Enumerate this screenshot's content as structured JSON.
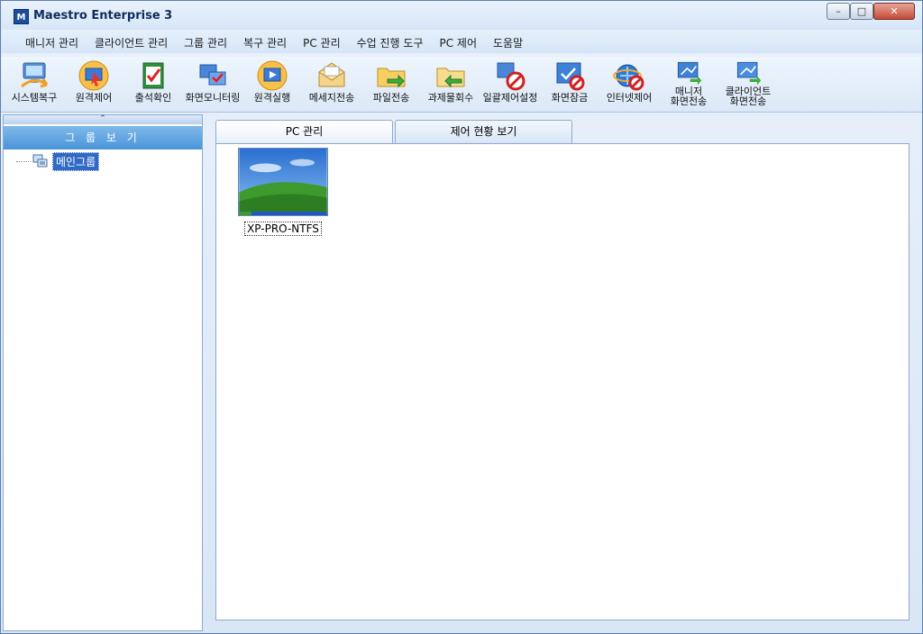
{
  "window": {
    "title": "Maestro Enterprise 3"
  },
  "menu": [
    "매니저 관리",
    "클라이언트 관리",
    "그룹 관리",
    "복구 관리",
    "PC 관리",
    "수업 진행 도구",
    "PC 제어",
    "도움말"
  ],
  "toolbar": [
    {
      "line1": "시스템복구",
      "line2": "",
      "icon": "system-restore-icon"
    },
    {
      "line1": "원격제어",
      "line2": "",
      "icon": "remote-control-icon"
    },
    {
      "line1": "출석확인",
      "line2": "",
      "icon": "attendance-icon"
    },
    {
      "line1": "화면모니터링",
      "line2": "",
      "icon": "screen-monitor-icon"
    },
    {
      "line1": "원격실행",
      "line2": "",
      "icon": "remote-execute-icon"
    },
    {
      "line1": "메세지전송",
      "line2": "",
      "icon": "message-icon"
    },
    {
      "line1": "파일전송",
      "line2": "",
      "icon": "file-send-icon"
    },
    {
      "line1": "과제물회수",
      "line2": "",
      "icon": "collect-assignment-icon"
    },
    {
      "line1": "일괄제어설정",
      "line2": "",
      "icon": "bulk-control-icon"
    },
    {
      "line1": "화면잠금",
      "line2": "",
      "icon": "screen-lock-icon"
    },
    {
      "line1": "인터넷제어",
      "line2": "",
      "icon": "internet-control-icon"
    },
    {
      "line1": "매니저",
      "line2": "화면전송",
      "icon": "manager-screen-send-icon"
    },
    {
      "line1": "클라이언트",
      "line2": "화면전송",
      "icon": "client-screen-send-icon"
    }
  ],
  "left_pane": {
    "header": "그 룹 보 기",
    "tree": [
      {
        "label": "메인그룹"
      }
    ]
  },
  "tabs": [
    "PC 관리",
    "제어 현황 보기"
  ],
  "pcs": [
    {
      "name": "XP-PRO-NTFS"
    }
  ],
  "colors": {
    "accent": "#4a94d9",
    "selection": "#316ac5"
  }
}
